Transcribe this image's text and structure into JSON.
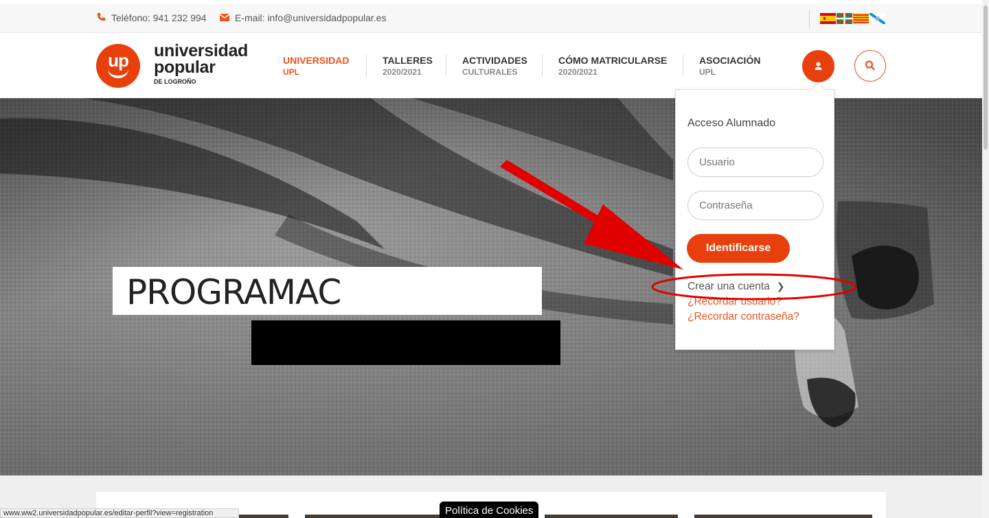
{
  "topbar": {
    "phone": "Teléfono: 941 232 994",
    "email": "E-mail: info@universidadpopular.es",
    "flags": [
      "spanish-flag-icon",
      "basque-flag-icon",
      "catalan-flag-icon",
      "galician-flag-icon"
    ]
  },
  "logo": {
    "mark": "up",
    "line1": "universidad",
    "line2": "popular",
    "line3": "DE LOGROÑO"
  },
  "nav": [
    {
      "title": "UNIVERSIDAD",
      "subtitle": "UPL",
      "active": true
    },
    {
      "title": "TALLERES",
      "subtitle": "2020/2021",
      "active": false
    },
    {
      "title": "ACTIVIDADES",
      "subtitle": "CULTURALES",
      "active": false
    },
    {
      "title": "CÓMO MATRICULARSE",
      "subtitle": "2020/2021",
      "active": false
    },
    {
      "title": "ASOCIACIÓN",
      "subtitle": "UPL",
      "active": false
    }
  ],
  "hero": {
    "title": "PROGRAMAC"
  },
  "login": {
    "heading": "Acceso Alumnado",
    "username_placeholder": "Usuario",
    "password_placeholder": "Contraseña",
    "submit_label": "Identificarse",
    "create_account": "Crear una cuenta",
    "remember_user": "¿Recordar usuario?",
    "remember_password": "¿Recordar contraseña?"
  },
  "footer": {
    "status_url": "www.ww2.universidadpopular.es/editar-perfil?view=registration",
    "cookie_label": "Política de Cookies"
  },
  "colors": {
    "brand": "#e8400c",
    "link": "#e8541e",
    "annotation": "#e00000"
  }
}
